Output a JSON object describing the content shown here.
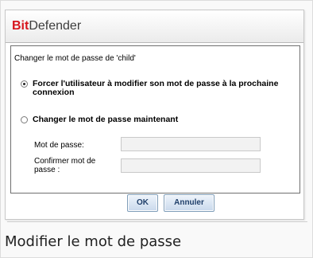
{
  "window": {
    "brand_prefix": "Bit",
    "brand_suffix": "Defender"
  },
  "dialog": {
    "prompt": "Changer le mot de passe de 'child'",
    "options": [
      {
        "label": "Forcer l'utilisateur à modifier son mot de passe à la prochaine connexion",
        "selected": true
      },
      {
        "label": "Changer le mot de passe maintenant",
        "selected": false
      }
    ],
    "fields": {
      "password_label": "Mot de passe:",
      "password_value": "",
      "confirm_label": "Confirmer mot de passe :",
      "confirm_value": ""
    },
    "buttons": {
      "ok": "OK",
      "cancel": "Annuler"
    }
  },
  "caption": "Modifier le mot de passe",
  "colors": {
    "brand_red": "#d7151d",
    "button_text": "#1f3f6a",
    "button_border": "#7f9db9"
  }
}
